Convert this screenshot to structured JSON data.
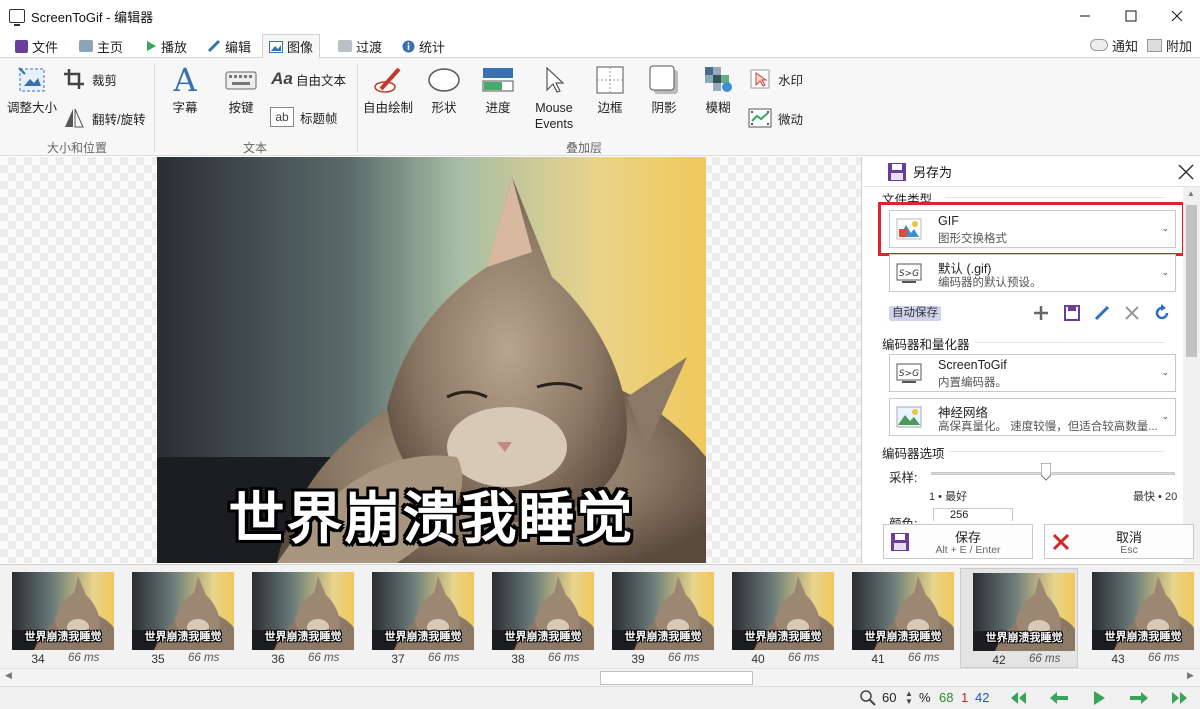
{
  "window": {
    "title": "ScreenToGif - 编辑器"
  },
  "tabs": [
    {
      "label": "文件"
    },
    {
      "label": "主页"
    },
    {
      "label": "播放"
    },
    {
      "label": "编辑"
    },
    {
      "label": "图像"
    },
    {
      "label": "过渡"
    },
    {
      "label": "统计"
    }
  ],
  "tabs_right": {
    "notify": "通知",
    "extras": "附加"
  },
  "ribbon": {
    "resize": "调整大小",
    "crop": "裁剪",
    "flip_rotate": "翻转/旋转",
    "subtitle": "字幕",
    "keystrokes": "按键",
    "free_text": "自由文本",
    "title_frame": "标题帧",
    "free_drawing": "自由绘制",
    "shapes": "形状",
    "progress": "进度",
    "mouse_events_1": "Mouse",
    "mouse_events_2": "Events",
    "border": "边框",
    "shadow": "阴影",
    "obfuscate": "模糊",
    "watermark": "水印",
    "cinemagraph": "微动",
    "group_size": "大小和位置",
    "group_text": "文本",
    "group_overlay": "叠加层"
  },
  "canvas": {
    "caption": "世界崩溃我睡觉"
  },
  "panel": {
    "title": "另存为",
    "section_file_type": "文件类型",
    "file_type": {
      "name": "GIF",
      "desc": "图形交换格式"
    },
    "preset": {
      "name": "默认 (.gif)",
      "desc": "编码器的默认预设。"
    },
    "autosave": "自动保存",
    "section_encoder": "编码器和量化器",
    "encoder": {
      "name": "ScreenToGif",
      "desc": "内置编码器。"
    },
    "quantizer": {
      "name": "神经网络",
      "desc": "高保真量化。 速度较慢，但适合较高数量..."
    },
    "section_options": "编码器选项",
    "sampling_label": "采样:",
    "sampling_min": "1 • 最好",
    "sampling_max": "最快 • 20",
    "sampling_value": 10,
    "colors_label": "颜色:",
    "colors_value": "256",
    "save": {
      "label": "保存",
      "shortcut": "Alt + E / Enter"
    },
    "cancel": {
      "label": "取消",
      "shortcut": "Esc"
    }
  },
  "timeline": {
    "caption": "世界崩溃我睡觉",
    "frames": [
      {
        "number": "34",
        "delay": "66 ms"
      },
      {
        "number": "35",
        "delay": "66 ms"
      },
      {
        "number": "36",
        "delay": "66 ms"
      },
      {
        "number": "37",
        "delay": "66 ms"
      },
      {
        "number": "38",
        "delay": "66 ms"
      },
      {
        "number": "39",
        "delay": "66 ms"
      },
      {
        "number": "40",
        "delay": "66 ms"
      },
      {
        "number": "41",
        "delay": "66 ms"
      },
      {
        "number": "42",
        "delay": "66 ms"
      },
      {
        "number": "43",
        "delay": "66 ms"
      }
    ],
    "selected_frame": "42"
  },
  "status": {
    "zoom": "60",
    "zoom_unit": "%",
    "frame_total": "68",
    "selected_count": "1",
    "current_frame": "42"
  },
  "colors": {
    "accent_red": "#e5202e",
    "total_green": "#2e8b2e",
    "selected_red": "#d42424",
    "current_blue": "#2255cc",
    "nav_green": "#3aa35a"
  }
}
